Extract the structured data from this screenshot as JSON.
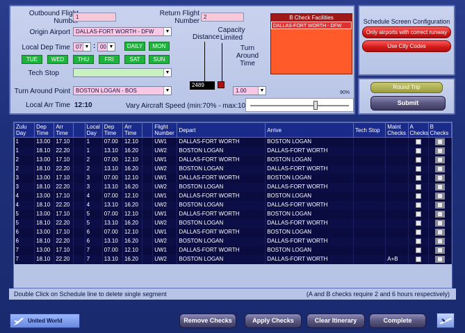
{
  "form": {
    "outbound_label": "Outbound Flight Number",
    "outbound_value": "1",
    "return_label": "Return Flight Number",
    "return_value": "2",
    "origin_label": "Origin Airport",
    "origin_value": "DALLAS-FORT WORTH  - DFW",
    "distance_label": "Distance",
    "capacity_label": "Capacity Limited",
    "local_dep_label": "Local Dep Time",
    "dep_hour": "07",
    "dep_min": "00",
    "days": [
      "DAILY",
      "MON",
      "TUE",
      "WED",
      "THU",
      "FRI",
      "SAT",
      "SUN"
    ],
    "turnaround_time_label": "Turn Around Time",
    "turnaround_time_value": "1.00",
    "tech_stop_label": "Tech Stop",
    "tech_stop_value": "",
    "turnaround_point_label": "Turn Around Point",
    "turnaround_point_value": "BOSTON LOGAN  - BOS",
    "distance_value": "2489",
    "local_arr_label": "Local Arr Time",
    "local_arr_value": "12:10",
    "speed_label": "Vary Aircraft Speed (min:70% - max:100%)",
    "speed_value": "90%",
    "speed_fraction": 0.67,
    "bcheck_title": "B Check Facilities",
    "bcheck_item": "DALLAS-FORT WORTH  - DFW"
  },
  "config": {
    "title": "Schedule Screen Configuration",
    "btn_runway": "Only airports with correct runway",
    "btn_city": "Use City Codes",
    "btn_round": "Round Trip",
    "btn_submit": "Submit"
  },
  "table": {
    "headers": [
      "Zulu Day",
      "Dep Time",
      "Arr Time",
      "",
      "Local Day",
      "Dep Time",
      "Arr Time",
      "",
      "Flight Number",
      "Depart",
      "Arrive",
      "Tech Stop",
      "Maint Checks",
      "A Checks",
      "B Checks"
    ],
    "rows": [
      [
        "1",
        "13.00",
        "17.10",
        "1",
        "07.00",
        "12.10",
        "UW1",
        "DALLAS-FORT WORTH",
        "BOSTON LOGAN",
        ""
      ],
      [
        "1",
        "18.10",
        "22.20",
        "1",
        "13.10",
        "16.20",
        "UW2",
        "BOSTON LOGAN",
        "DALLAS-FORT WORTH",
        ""
      ],
      [
        "2",
        "13.00",
        "17.10",
        "2",
        "07.00",
        "12.10",
        "UW1",
        "DALLAS-FORT WORTH",
        "BOSTON LOGAN",
        ""
      ],
      [
        "2",
        "18.10",
        "22.20",
        "2",
        "13.10",
        "16.20",
        "UW2",
        "BOSTON LOGAN",
        "DALLAS-FORT WORTH",
        ""
      ],
      [
        "3",
        "13.00",
        "17.10",
        "3",
        "07.00",
        "12.10",
        "UW1",
        "DALLAS-FORT WORTH",
        "BOSTON LOGAN",
        ""
      ],
      [
        "3",
        "18.10",
        "22.20",
        "3",
        "13.10",
        "16.20",
        "UW2",
        "BOSTON LOGAN",
        "DALLAS-FORT WORTH",
        ""
      ],
      [
        "4",
        "13.00",
        "17.10",
        "4",
        "07.00",
        "12.10",
        "UW1",
        "DALLAS-FORT WORTH",
        "BOSTON LOGAN",
        ""
      ],
      [
        "4",
        "18.10",
        "22.20",
        "4",
        "13.10",
        "16.20",
        "UW2",
        "BOSTON LOGAN",
        "DALLAS-FORT WORTH",
        ""
      ],
      [
        "5",
        "13.00",
        "17.10",
        "5",
        "07.00",
        "12.10",
        "UW1",
        "DALLAS-FORT WORTH",
        "BOSTON LOGAN",
        ""
      ],
      [
        "5",
        "18.10",
        "22.20",
        "5",
        "13.10",
        "16.20",
        "UW2",
        "BOSTON LOGAN",
        "DALLAS-FORT WORTH",
        ""
      ],
      [
        "6",
        "13.00",
        "17.10",
        "6",
        "07.00",
        "12.10",
        "UW1",
        "DALLAS-FORT WORTH",
        "BOSTON LOGAN",
        ""
      ],
      [
        "6",
        "18.10",
        "22.20",
        "6",
        "13.10",
        "16.20",
        "UW2",
        "BOSTON LOGAN",
        "DALLAS-FORT WORTH",
        ""
      ],
      [
        "7",
        "13.00",
        "17.10",
        "7",
        "07.00",
        "12.10",
        "UW1",
        "DALLAS-FORT WORTH",
        "BOSTON LOGAN",
        ""
      ],
      [
        "7",
        "18.10",
        "22.20",
        "7",
        "13.10",
        "16.20",
        "UW2",
        "BOSTON LOGAN",
        "DALLAS-FORT WORTH",
        "A+B"
      ]
    ]
  },
  "footer": {
    "hint_left": "Double Click on Schedule line to delete single segment",
    "hint_right": "(A and B checks require 2 and 6 hours respectively)",
    "airline": "United World",
    "btn_remove": "Remove Checks",
    "btn_apply": "Apply Checks",
    "btn_clear": "Clear Itinerary",
    "btn_complete": "Complete"
  },
  "colors": {
    "header": "#1a2a8a",
    "row": "#0a0c40",
    "green": "#1fb23c",
    "red": "#d01818"
  }
}
